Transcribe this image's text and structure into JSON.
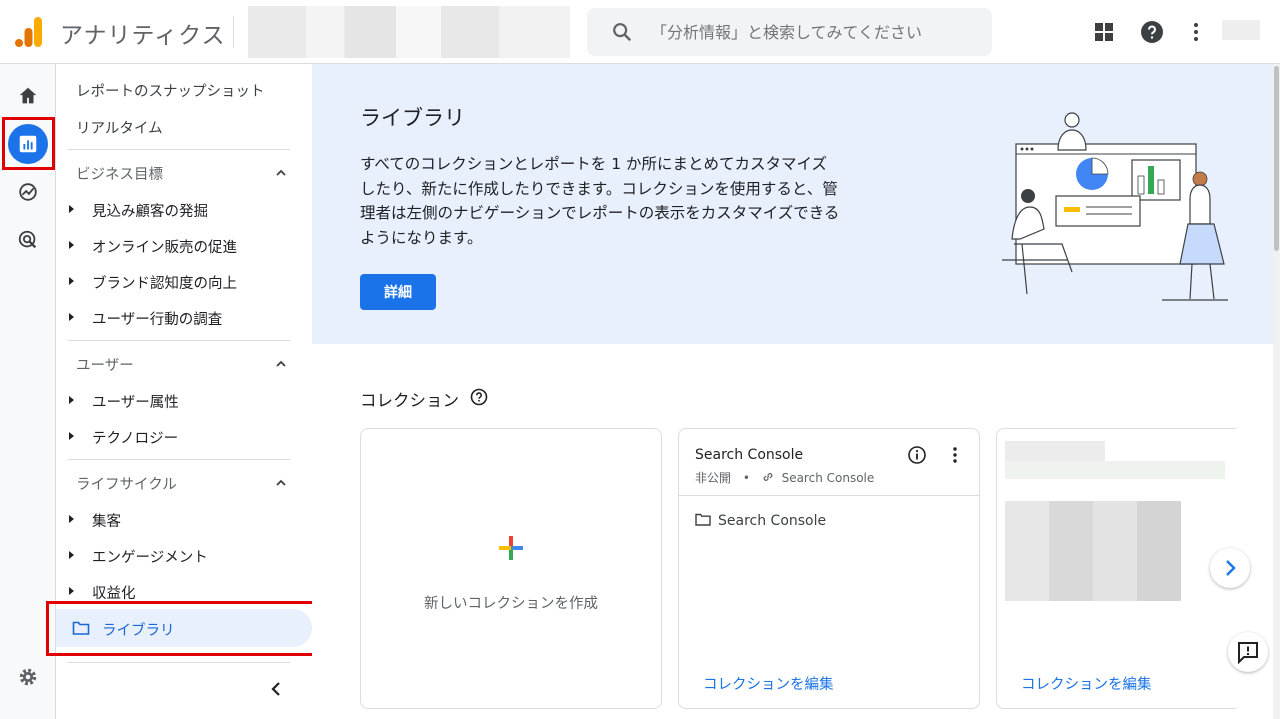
{
  "app": {
    "title": "アナリティクス"
  },
  "search": {
    "placeholder": "「分析情報」と検索してみてください"
  },
  "header": {
    "icons": [
      "apps-icon",
      "help-icon",
      "more-vert-icon"
    ]
  },
  "rail": {
    "items": [
      "home-icon",
      "reports-icon",
      "explore-icon",
      "advertising-icon",
      "settings-icon"
    ],
    "active": "reports-icon"
  },
  "nav": {
    "snapshot": "レポートのスナップショット",
    "realtime": "リアルタイム",
    "sections": [
      {
        "label": "ビジネス目標",
        "items": [
          "見込み顧客の発掘",
          "オンライン販売の促進",
          "ブランド認知度の向上",
          "ユーザー行動の調査"
        ]
      },
      {
        "label": "ユーザー",
        "items": [
          "ユーザー属性",
          "テクノロジー"
        ]
      },
      {
        "label": "ライフサイクル",
        "items": [
          "集客",
          "エンゲージメント",
          "収益化"
        ]
      }
    ],
    "library": "ライブラリ"
  },
  "hero": {
    "title": "ライブラリ",
    "text": "すべてのコレクションとレポートを 1 か所にまとめてカスタマイズしたり、新たに作成したりできます。コレクションを使用すると、管理者は左側のナビゲーションでレポートの表示をカスタマイズできるようになります。",
    "button": "詳細"
  },
  "collections": {
    "title": "コレクション",
    "new_card": {
      "label": "新しいコレクションを作成"
    },
    "search_console": {
      "title": "Search Console",
      "visibility": "非公開",
      "separator": "•",
      "linked": "Search Console",
      "item": "Search Console",
      "edit": "コレクションを編集"
    },
    "third_card": {
      "edit": "コレクションを編集"
    }
  },
  "colors": {
    "accent": "#1a73e8",
    "highlight": "#e00000",
    "hero_bg": "#e8f0fe"
  }
}
